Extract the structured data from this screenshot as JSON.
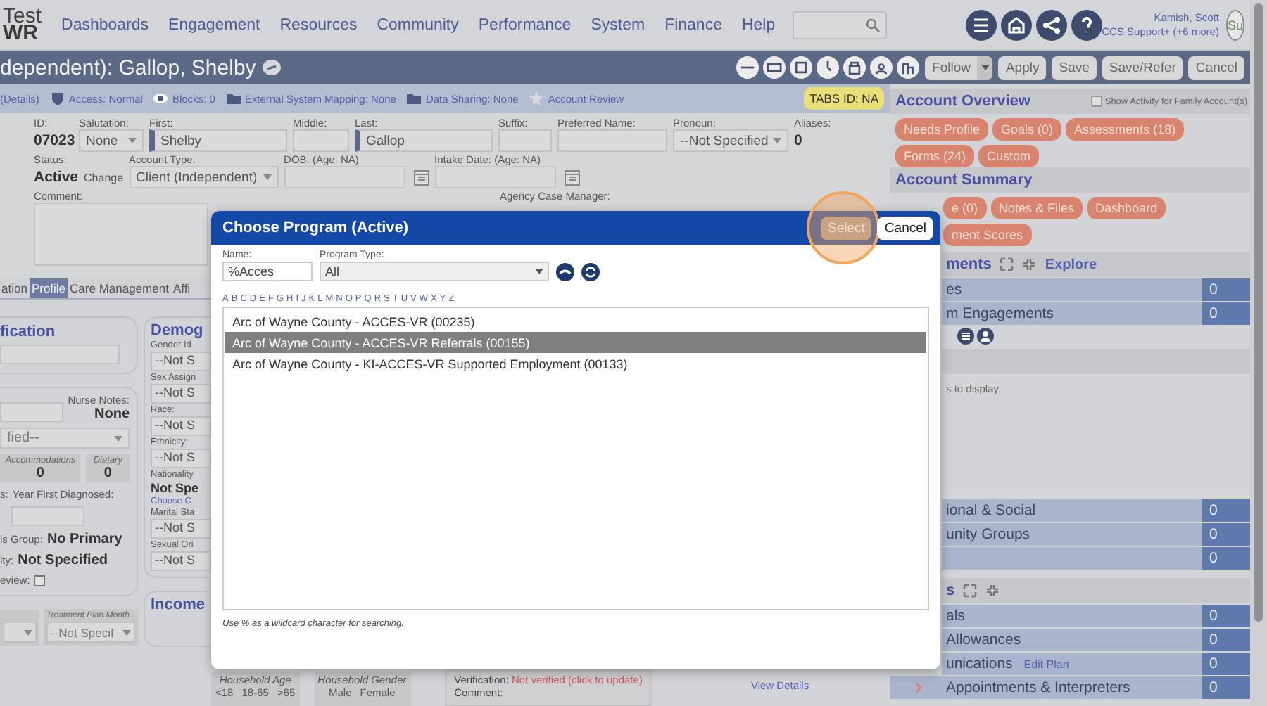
{
  "nav": {
    "logo_top": "Test",
    "logo_bottom": "WR",
    "menu": [
      "Dashboards",
      "Engagement",
      "Resources",
      "Community",
      "Performance",
      "System",
      "Finance",
      "Help"
    ],
    "user": {
      "name": "Kamish, Scott",
      "role": "CCS Support+ (+6 more)",
      "avatar_text": "Su"
    }
  },
  "title_bar": {
    "title": "dependent): Gallop, Shelby",
    "buttons": [
      {
        "label": "Follow",
        "kind": "split"
      },
      {
        "label": "Apply",
        "kind": "plain"
      },
      {
        "label": "Save",
        "kind": "plain"
      },
      {
        "label": "Save/Refer",
        "kind": "plain"
      },
      {
        "label": "Cancel",
        "kind": "plain"
      }
    ]
  },
  "info_strip": {
    "items": [
      "(Details)",
      "Access: Normal",
      "Blocks: 0",
      "External System Mapping: None",
      "Data Sharing: None",
      "Account Review"
    ],
    "badge": "TABS ID: NA"
  },
  "profile": {
    "identity": [
      {
        "kind": "value",
        "label": "ID:",
        "value": "07023"
      },
      {
        "kind": "select",
        "label": "Salutation:",
        "value": "None"
      },
      {
        "kind": "input",
        "label": "First:",
        "value": "Shelby",
        "required": true
      },
      {
        "kind": "input",
        "label": "Middle:",
        "required": false
      },
      {
        "kind": "input",
        "label": "Last:",
        "value": "Gallop",
        "required": true
      },
      {
        "kind": "input",
        "label": "Suffix:",
        "required": false
      },
      {
        "kind": "input",
        "label": "Preferred Name:",
        "required": false
      },
      {
        "kind": "select",
        "label": "Pronoun:",
        "value": "--Not Specified"
      },
      {
        "kind": "value",
        "label": "Aliases:",
        "value": "0"
      }
    ],
    "status": [
      {
        "kind": "status",
        "label": "Status:",
        "value": "Active",
        "link": "Change"
      },
      {
        "kind": "select",
        "label": "Account Type:",
        "value": "Client (Independent)"
      },
      {
        "kind": "date",
        "label": "DOB: (Age: NA)"
      },
      {
        "kind": "date",
        "label": "Intake Date: (Age: NA)"
      }
    ],
    "notes": [
      {
        "kind": "textarea",
        "label": "Comment:"
      },
      {
        "kind": "label",
        "label": "Agency Case Manager:"
      }
    ]
  },
  "tabs": [
    {
      "label": "ation",
      "selected": false
    },
    {
      "label": "Profile",
      "selected": true
    },
    {
      "label": "Care Management",
      "selected": false
    },
    {
      "label": "Affi",
      "selected": false
    }
  ],
  "identification": {
    "title": "fication"
  },
  "details": {
    "nurse_notes_label": "Nurse Notes:",
    "nurse_notes": "None",
    "select_value": "fied--",
    "counters": [
      {
        "label": "Accommodations",
        "value": "0"
      },
      {
        "label": "Dietary",
        "value": "0"
      }
    ],
    "diagnosis_labels": [
      "s:",
      "Year First Diagnosed:"
    ],
    "group": {
      "label": "is Group:",
      "value": "No Primary"
    },
    "ethnicity": {
      "label": "ity:",
      "value": "Not Specified"
    },
    "review": {
      "label": "eview:",
      "checked": false
    }
  },
  "plan": {
    "month_label": "Treatment Plan Month",
    "month_value": "--Not Specif"
  },
  "demographics": {
    "title": "Demog",
    "fields": [
      {
        "kind": "select",
        "label": "Gender Id",
        "value": "--Not S"
      },
      {
        "kind": "select",
        "label": "Sex Assign",
        "value": "--Not S"
      },
      {
        "kind": "select",
        "label": "Race:",
        "value": "--Not S"
      },
      {
        "kind": "select",
        "label": "Ethnicity:",
        "value": "--Not S"
      },
      {
        "kind": "text",
        "label": "Nationality",
        "value": "Not Spe",
        "link": "Choose C"
      },
      {
        "kind": "select",
        "label": "Marital Sta",
        "value": "--Not S"
      },
      {
        "kind": "select",
        "label": "Sexual Ori",
        "value": "--Not S"
      }
    ]
  },
  "income": {
    "title": "Income",
    "household_age": {
      "label": "Household Age",
      "columns": [
        "<18",
        "18-65",
        ">65"
      ]
    },
    "household_gender": {
      "label": "Household Gender",
      "columns": [
        "Male",
        "Female"
      ]
    }
  },
  "verification": {
    "label": "Verification:",
    "value": "Not verified (click to update)",
    "comment_label": "Comment:"
  },
  "view_details": "View Details",
  "modal": {
    "title": "Choose Program (Active)",
    "buttons": [
      {
        "label": "Select",
        "disabled": true,
        "highlighted": true
      },
      {
        "label": "Cancel",
        "disabled": false,
        "highlighted": false
      }
    ],
    "name": {
      "label": "Name:",
      "value": "%Acces"
    },
    "program_type": {
      "label": "Program Type:",
      "value": "All"
    },
    "letters": [
      "A",
      "B",
      "C",
      "D",
      "E",
      "F",
      "G",
      "H",
      "I",
      "J",
      "K",
      "L",
      "M",
      "N",
      "O",
      "P",
      "Q",
      "R",
      "S",
      "T",
      "U",
      "V",
      "W",
      "X",
      "Y",
      "Z"
    ],
    "programs": [
      {
        "label": "Arc of Wayne County - ACCES-VR (00235)",
        "selected": false
      },
      {
        "label": "Arc of Wayne County - ACCES-VR Referrals (00155)",
        "selected": true
      },
      {
        "label": "Arc of Wayne County - KI-ACCES-VR Supported Employment (00133)",
        "selected": false
      }
    ],
    "hint": "Use % as a wildcard character for searching."
  },
  "account_overview": {
    "title": "Account Overview",
    "family_toggle": {
      "label": "Show Activity for Family Account(s)",
      "checked": false
    },
    "buttons": [
      "Needs Profile",
      "Goals (0)",
      "Assessments (18)",
      "Forms (24)",
      "Custom"
    ]
  },
  "account_summary": {
    "title": "Account Summary",
    "buttons": [
      "e (0)",
      "Notes & Files",
      "Dashboard",
      "ment Scores"
    ]
  },
  "engagements": {
    "title": "ments",
    "explore": "Explore",
    "rows": [
      {
        "label": "es",
        "count": "0"
      },
      {
        "label": "m Engagements",
        "count": "0"
      }
    ]
  },
  "activity": {
    "empty_text": "s to display."
  },
  "groups": {
    "rows": [
      {
        "label": "ional & Social",
        "count": "0"
      },
      {
        "label": "unity Groups",
        "count": "0"
      },
      {
        "count": "0"
      }
    ]
  },
  "services": {
    "title": "s",
    "rows": [
      {
        "label": "als",
        "count": "0",
        "expandable": false
      },
      {
        "label": "Allowances",
        "count": "0",
        "expandable": false
      },
      {
        "label": "unications",
        "link": "Edit Plan",
        "count": "0",
        "expandable": false
      },
      {
        "label": "Appointments & Interpreters",
        "count": "0",
        "expandable": true
      }
    ]
  }
}
